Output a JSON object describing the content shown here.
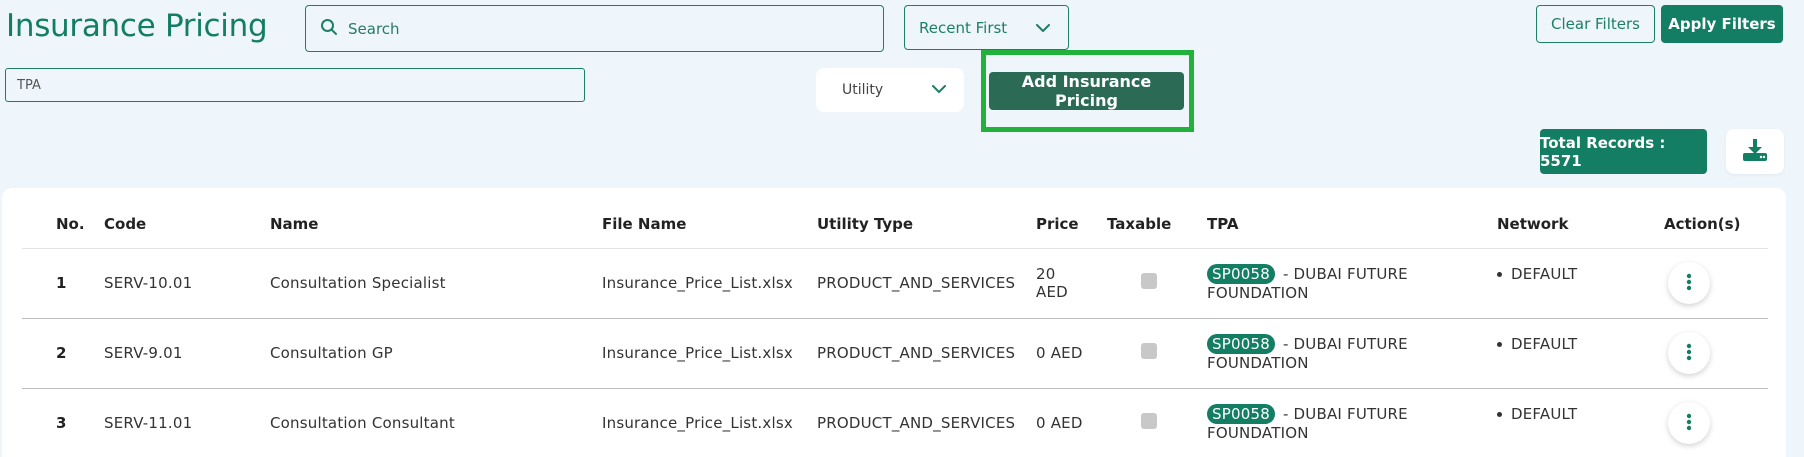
{
  "header": {
    "title": "Insurance Pricing",
    "search_placeholder": "Search",
    "sort_selected": "Recent First",
    "clear_filters_label": "Clear Filters",
    "apply_filters_label": "Apply Filters"
  },
  "filters": {
    "tpa_placeholder": "TPA",
    "utility_selected": "Utility",
    "add_button_label": "Add Insurance Pricing"
  },
  "summary": {
    "total_records_label": "Total Records : 5571"
  },
  "table": {
    "columns": [
      "No.",
      "Code",
      "Name",
      "File Name",
      "Utility Type",
      "Price",
      "Taxable",
      "TPA",
      "Network",
      "Action(s)"
    ],
    "rows": [
      {
        "no": "1",
        "code": "SERV-10.01",
        "name": "Consultation Specialist",
        "file_name": "Insurance_Price_List.xlsx",
        "utility_type": "PRODUCT_AND_SERVICES",
        "price": "20 AED",
        "tpa_code": "SP0058",
        "tpa_name": "- DUBAI FUTURE FOUNDATION",
        "network": "DEFAULT"
      },
      {
        "no": "2",
        "code": "SERV-9.01",
        "name": "Consultation GP",
        "file_name": "Insurance_Price_List.xlsx",
        "utility_type": "PRODUCT_AND_SERVICES",
        "price": "0 AED",
        "tpa_code": "SP0058",
        "tpa_name": "- DUBAI FUTURE FOUNDATION",
        "network": "DEFAULT"
      },
      {
        "no": "3",
        "code": "SERV-11.01",
        "name": "Consultation Consultant",
        "file_name": "Insurance_Price_List.xlsx",
        "utility_type": "PRODUCT_AND_SERVICES",
        "price": "0 AED",
        "tpa_code": "SP0058",
        "tpa_name": "- DUBAI FUTURE FOUNDATION",
        "network": "DEFAULT"
      }
    ]
  },
  "colors": {
    "brand_green": "#137e64",
    "highlight_green": "#22b23c",
    "page_bg": "#eef6fb"
  },
  "icons": {
    "search": "search-icon",
    "chevron": "chevron-down-icon",
    "download": "download-icon",
    "more": "more-vertical-icon"
  }
}
